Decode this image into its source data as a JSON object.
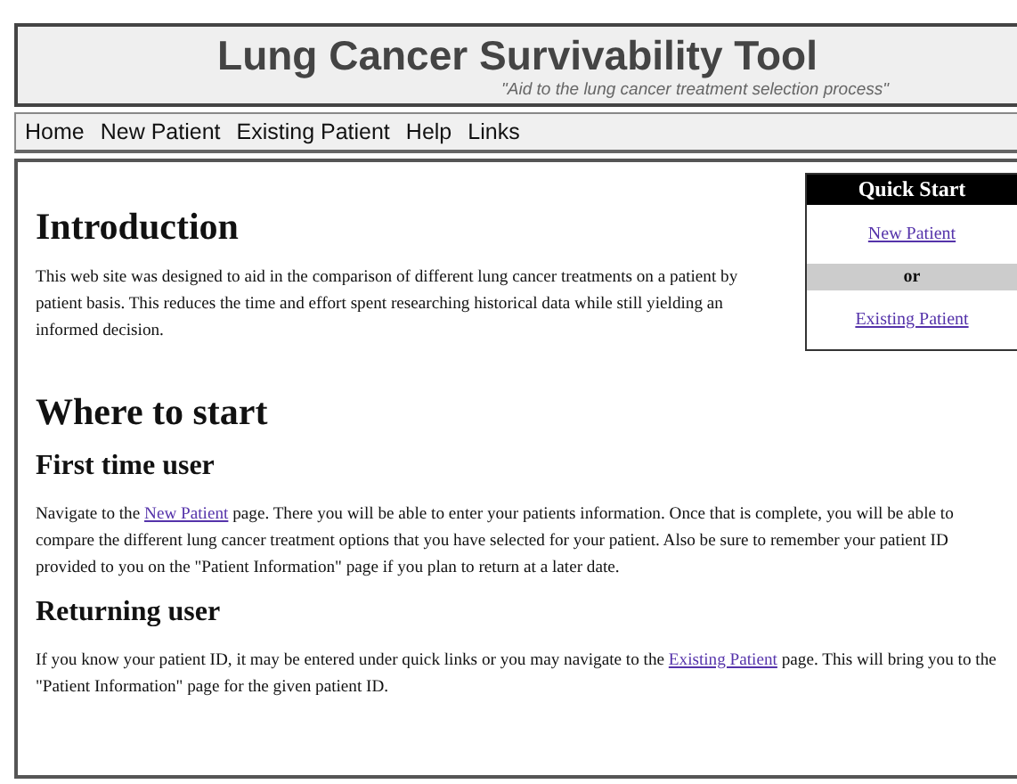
{
  "header": {
    "title": "Lung Cancer Survivability Tool",
    "subtitle": "\"Aid to the lung cancer treatment selection process\""
  },
  "nav": [
    "Home",
    "New Patient",
    "Existing Patient",
    "Help",
    "Links"
  ],
  "quick_start": {
    "title": "Quick Start",
    "links": [
      {
        "kind": "link",
        "text": "New Patient"
      },
      {
        "kind": "separator",
        "text": "or"
      },
      {
        "kind": "link",
        "text": "Existing Patient"
      }
    ]
  },
  "sections": [
    {
      "kind": "h1",
      "text": "Introduction"
    },
    {
      "kind": "p",
      "parts": [
        {
          "kind": "text",
          "text": "This web site was designed to aid in the comparison of different lung cancer treatments on a patient by patient basis.  This reduces the time and effort spent researching historical data while still yielding an informed decision."
        }
      ]
    },
    {
      "kind": "h1",
      "text": "Where to start"
    },
    {
      "kind": "h2",
      "text": "First time user"
    },
    {
      "kind": "p",
      "parts": [
        {
          "kind": "text",
          "text": "Navigate to the "
        },
        {
          "kind": "link",
          "text": "New Patient"
        },
        {
          "kind": "text",
          "text": " page.  There you will be able to enter your patients information.  Once that is complete, you will be able to compare the different lung cancer treatment options that you have selected for your patient.  Also be sure to remember your patient ID provided to you on the \"Patient Information\" page if you plan to return at a later date."
        }
      ]
    },
    {
      "kind": "h2",
      "text": "Returning user"
    },
    {
      "kind": "p",
      "parts": [
        {
          "kind": "text",
          "text": "If you know your patient ID, it may be entered under quick links or you may navigate to the "
        },
        {
          "kind": "link",
          "text": "Existing Patient"
        },
        {
          "kind": "text",
          "text": " page.  This will bring you to the \"Patient Information\" page for the given patient ID."
        }
      ]
    }
  ]
}
